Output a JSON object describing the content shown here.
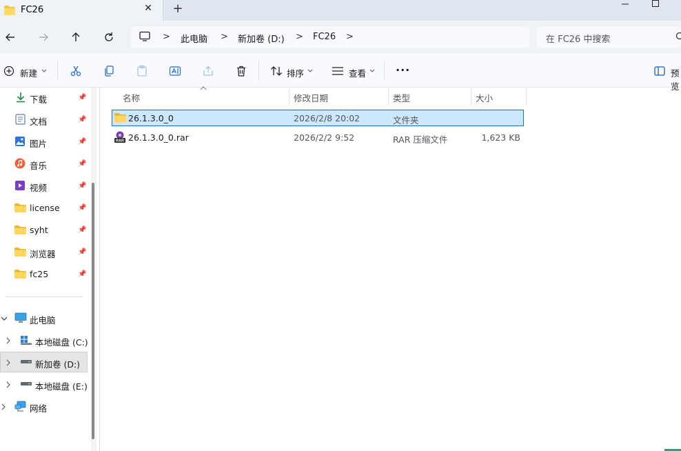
{
  "window": {
    "tab_title": "FC26",
    "close_glyph": "✕",
    "new_tab_glyph": "+"
  },
  "nav": {
    "breadcrumb": [
      "此电脑",
      "新加卷 (D:)",
      "FC26"
    ],
    "search_placeholder": "在 FC26 中搜索"
  },
  "toolbar": {
    "new_label": "新建",
    "sort_label": "排序",
    "view_label": "查看",
    "more_label": "···",
    "preview_label": "预览"
  },
  "sidebar": {
    "quick": [
      {
        "label": "下载",
        "icon": "download-icon"
      },
      {
        "label": "文档",
        "icon": "document-icon"
      },
      {
        "label": "图片",
        "icon": "picture-icon"
      },
      {
        "label": "音乐",
        "icon": "music-icon"
      },
      {
        "label": "视频",
        "icon": "video-icon"
      },
      {
        "label": "license",
        "icon": "folder-icon"
      },
      {
        "label": "syht",
        "icon": "folder-icon"
      },
      {
        "label": "浏览器",
        "icon": "folder-icon"
      },
      {
        "label": "fc25",
        "icon": "folder-icon"
      }
    ],
    "this_pc": "此电脑",
    "drives": [
      "本地磁盘 (C:)",
      "新加卷 (D:)",
      "本地磁盘 (E:)"
    ],
    "network": "网络"
  },
  "list": {
    "headers": {
      "name": "名称",
      "date": "修改日期",
      "type": "类型",
      "size": "大小"
    },
    "rows": [
      {
        "name": "26.1.3.0_0",
        "date": "2026/2/8 20:02",
        "type": "文件夹",
        "size": "",
        "icon": "folder-icon",
        "selected": true
      },
      {
        "name": "26.1.3.0_0.rar",
        "date": "2026/2/2 9:52",
        "type": "RAR 压缩文件",
        "size": "1,623 KB",
        "icon": "rar-icon",
        "selected": false
      }
    ]
  },
  "colors": {
    "accent": "#1a6fc9",
    "selection": "#cce8ff",
    "folder": "#f4c542"
  }
}
